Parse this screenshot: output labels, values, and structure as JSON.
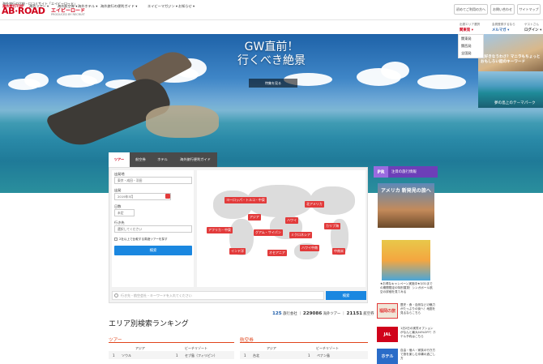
{
  "header": {
    "tagline": "海外旅行の比較・口コミサイト「エイビーロード」",
    "logo_main": "AB·ROAD",
    "logo_kana": "エイビーロード",
    "logo_sub": "PRODUCED BY RECRUIT",
    "buttons": [
      "初めてご利用の方へ",
      "お問い合わせ",
      "サイトマップ"
    ]
  },
  "nav": {
    "items": [
      "海外旅行TOP",
      "海外ツアー ▾",
      "海外航空券 ▾",
      "海外ホテル ▾",
      "海外旅行の便利ガイド ▾",
      "エイビーマガジン ▾",
      "お知らせ ▾"
    ],
    "account": {
      "area_label": "出発エリア選択",
      "area_value": "関東発 ▾",
      "member_label": "会員登録するなら",
      "member_value": "メルマガ ▾",
      "guest_label": "ゲストさん",
      "guest_value": "ログイン ▾"
    },
    "dropdown": [
      "関東発",
      "関西発",
      "全国発"
    ]
  },
  "hero": {
    "title_line1": "GW直前！",
    "title_line2": "行くべき絶景",
    "button": "特集を見る"
  },
  "promos": {
    "promo1_caption": "旅好きなうわさ？マニラもちょっとおもしろい話のキーワード",
    "promo2_caption": "夢の島上のテーマパーク"
  },
  "search": {
    "tabs": [
      "ツアー",
      "航空券",
      "ホテル",
      "海外旅行便利ガイド"
    ],
    "form": {
      "depart_label": "出発地",
      "depart_value": "東京・成田・羽田",
      "date_label": "出発",
      "date_value": "2019年5月",
      "days_label": "日数",
      "days_value": "未定",
      "dest_label": "行き先",
      "dest_value": "選択してください",
      "checkbox_label": "2社以上で比較する周遊ツアーを探す",
      "submit": "検索"
    },
    "keyword_placeholder": "行き先・航空会社・キーワードを入れてください",
    "keyword_button": "検索"
  },
  "map_pins": [
    "ヨーロッパ・トルコ・中東",
    "北アメリカ",
    "アジア",
    "ハワイ",
    "カリブ海",
    "アフリカ・中東",
    "グアム・サイパン",
    "ミクロネシア",
    "ハワイ中南",
    "インド洋",
    "オセアニア",
    "中南米"
  ],
  "right_column": {
    "header": "注目の旅行情報",
    "pr_badge": "PR",
    "ad1_text": "アメリカ 新発見の旅へ",
    "ad2_text": "★お得なキャンペーン実施中★3/31までの期間限定の特別運賃！シンガポール航空の詳細を見てみる",
    "items": [
      "歴史・食・自然などの魅力がたっぷりの街へ！地図を見るならこちら",
      "1泊2日の実質オプションがなんと最大44%OFF！ホテル予約はこちら",
      "自由・個人・家族の行き方で旅を楽しむ沖縄の過ごし方"
    ],
    "thumb_labels": [
      "福岡の旅",
      "JAL",
      "ホテル"
    ]
  },
  "stats": {
    "a_num": "125",
    "a_label": "旅行会社",
    "b_num": "229086",
    "b_label": "海外ツアー",
    "c_num": "21151",
    "c_label": "航空券"
  },
  "ranking": {
    "title": "エリア別検索ランキング",
    "sections": [
      {
        "title": "ツアー",
        "cols": [
          "アジア",
          "ビーチリゾート"
        ],
        "row": [
          "1",
          "ソウル",
          "1",
          "セブ島（フィリピン）"
        ]
      },
      {
        "title": "航空券",
        "cols": [
          "アジア",
          "ビーチリゾート"
        ],
        "row": [
          "1",
          "台北",
          "1",
          "ペナン島"
        ]
      }
    ]
  }
}
